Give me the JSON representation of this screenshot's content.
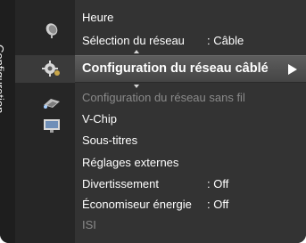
{
  "sidebar": {
    "title": "Configuration"
  },
  "icons": [
    "satellite-dish-icon",
    "gear-icon",
    "network-icon",
    "monitor-icon"
  ],
  "menu": {
    "items": [
      {
        "label": "Heure",
        "value": "",
        "enabled": true
      },
      {
        "label": "Sélection du réseau",
        "value": ": Câble",
        "enabled": true
      },
      {
        "label": "Configuration du réseau câblé",
        "value": "",
        "enabled": true,
        "selected": true
      },
      {
        "label": "Configuration du réseau sans fil",
        "value": "",
        "enabled": false
      },
      {
        "label": "V-Chip",
        "value": "",
        "enabled": true
      },
      {
        "label": "Sous-titres",
        "value": "",
        "enabled": true
      },
      {
        "label": "Réglages externes",
        "value": "",
        "enabled": true
      },
      {
        "label": "Divertissement",
        "value": ": Off",
        "enabled": true
      },
      {
        "label": "Économiseur énergie",
        "value": ": Off",
        "enabled": true
      },
      {
        "label": "ISI",
        "value": "",
        "enabled": false
      }
    ]
  }
}
